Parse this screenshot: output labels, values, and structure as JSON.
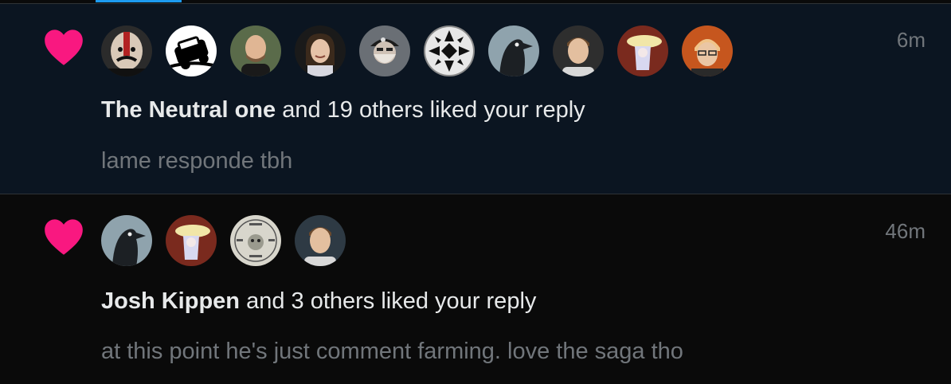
{
  "colors": {
    "heart": "#f91880",
    "unread_bg": "#0b1521",
    "read_bg": "#0a0a0a",
    "primary_text": "#e7e9ea",
    "secondary_text": "#71767b",
    "accent": "#1d9bf0"
  },
  "notifications": [
    {
      "icon": "heart-icon",
      "time": "6m",
      "actor": "The Neutral one",
      "rest": " and 19 others liked your reply",
      "snippet": "lame responde tbh",
      "avatars": [
        "avatar-painted-face",
        "avatar-car-logo",
        "avatar-bald-man",
        "avatar-woman-smiling",
        "avatar-bearded-man-cap",
        "avatar-geometric-pattern",
        "avatar-crow",
        "avatar-young-man",
        "avatar-anime-cowboy",
        "avatar-orange-hair-man"
      ]
    },
    {
      "icon": "heart-icon",
      "time": "46m",
      "actor": "Josh Kippen",
      "rest": " and 3 others liked your reply",
      "snippet": "at this point he's just comment farming. love the saga tho",
      "avatars": [
        "avatar-crow",
        "avatar-anime-cowboy",
        "avatar-circle-text-badge",
        "avatar-young-man"
      ]
    }
  ]
}
